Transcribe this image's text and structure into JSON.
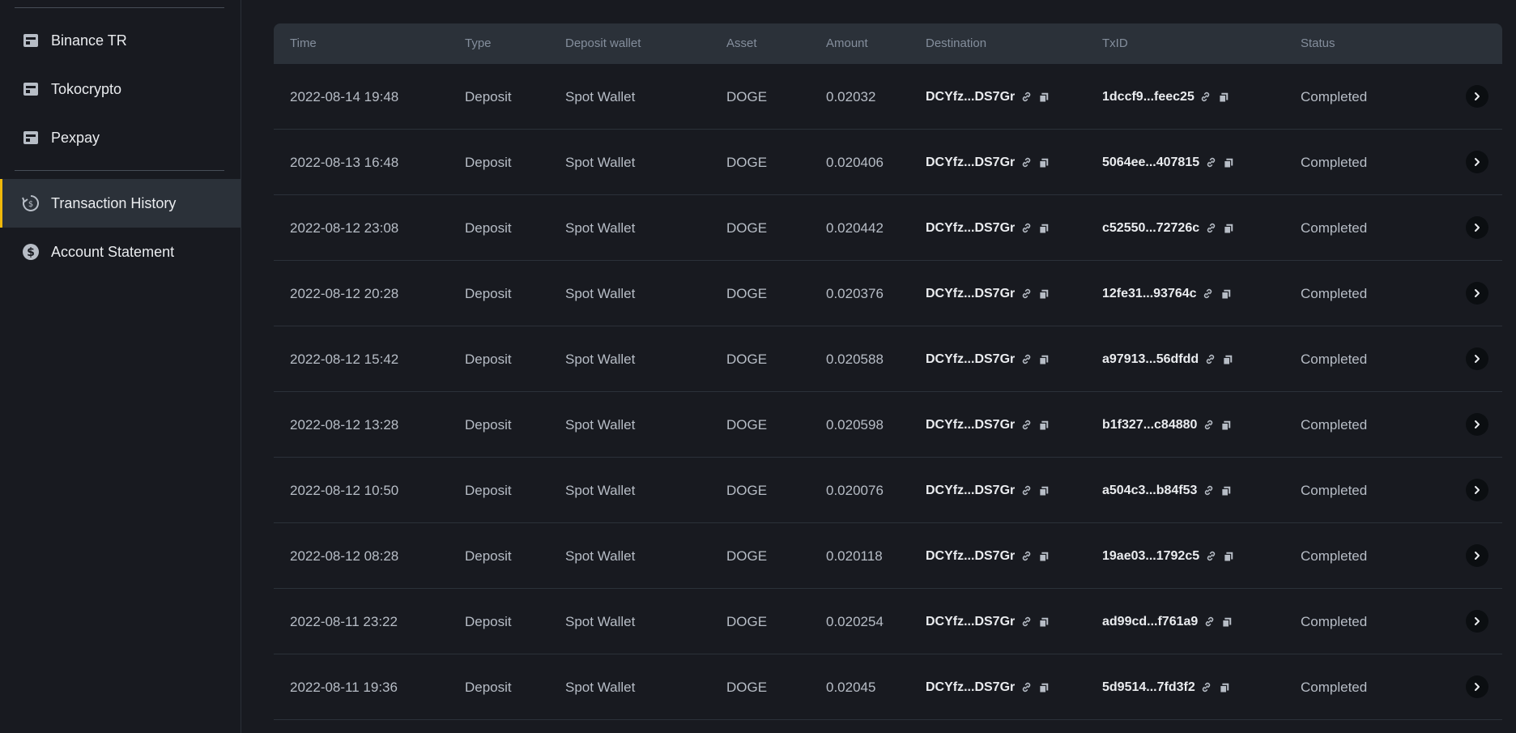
{
  "sidebar": {
    "items": [
      {
        "label": "Binance TR",
        "icon": "wallet-icon"
      },
      {
        "label": "Tokocrypto",
        "icon": "wallet-icon"
      },
      {
        "label": "Pexpay",
        "icon": "wallet-icon"
      },
      {
        "label": "Transaction History",
        "icon": "history-dollar-icon",
        "active": true
      },
      {
        "label": "Account Statement",
        "icon": "dollar-circle-icon"
      }
    ]
  },
  "table": {
    "headers": {
      "time": "Time",
      "type": "Type",
      "wallet": "Deposit wallet",
      "asset": "Asset",
      "amount": "Amount",
      "destination": "Destination",
      "txid": "TxID",
      "status": "Status"
    },
    "rows": [
      {
        "time": "2022-08-14 19:48",
        "type": "Deposit",
        "wallet": "Spot Wallet",
        "asset": "DOGE",
        "amount": "0.02032",
        "destination": "DCYfz...DS7Gr",
        "txid": "1dccf9...feec25",
        "status": "Completed"
      },
      {
        "time": "2022-08-13 16:48",
        "type": "Deposit",
        "wallet": "Spot Wallet",
        "asset": "DOGE",
        "amount": "0.020406",
        "destination": "DCYfz...DS7Gr",
        "txid": "5064ee...407815",
        "status": "Completed"
      },
      {
        "time": "2022-08-12 23:08",
        "type": "Deposit",
        "wallet": "Spot Wallet",
        "asset": "DOGE",
        "amount": "0.020442",
        "destination": "DCYfz...DS7Gr",
        "txid": "c52550...72726c",
        "status": "Completed"
      },
      {
        "time": "2022-08-12 20:28",
        "type": "Deposit",
        "wallet": "Spot Wallet",
        "asset": "DOGE",
        "amount": "0.020376",
        "destination": "DCYfz...DS7Gr",
        "txid": "12fe31...93764c",
        "status": "Completed"
      },
      {
        "time": "2022-08-12 15:42",
        "type": "Deposit",
        "wallet": "Spot Wallet",
        "asset": "DOGE",
        "amount": "0.020588",
        "destination": "DCYfz...DS7Gr",
        "txid": "a97913...56dfdd",
        "status": "Completed"
      },
      {
        "time": "2022-08-12 13:28",
        "type": "Deposit",
        "wallet": "Spot Wallet",
        "asset": "DOGE",
        "amount": "0.020598",
        "destination": "DCYfz...DS7Gr",
        "txid": "b1f327...c84880",
        "status": "Completed"
      },
      {
        "time": "2022-08-12 10:50",
        "type": "Deposit",
        "wallet": "Spot Wallet",
        "asset": "DOGE",
        "amount": "0.020076",
        "destination": "DCYfz...DS7Gr",
        "txid": "a504c3...b84f53",
        "status": "Completed"
      },
      {
        "time": "2022-08-12 08:28",
        "type": "Deposit",
        "wallet": "Spot Wallet",
        "asset": "DOGE",
        "amount": "0.020118",
        "destination": "DCYfz...DS7Gr",
        "txid": "19ae03...1792c5",
        "status": "Completed"
      },
      {
        "time": "2022-08-11 23:22",
        "type": "Deposit",
        "wallet": "Spot Wallet",
        "asset": "DOGE",
        "amount": "0.020254",
        "destination": "DCYfz...DS7Gr",
        "txid": "ad99cd...f761a9",
        "status": "Completed"
      },
      {
        "time": "2022-08-11 19:36",
        "type": "Deposit",
        "wallet": "Spot Wallet",
        "asset": "DOGE",
        "amount": "0.02045",
        "destination": "DCYfz...DS7Gr",
        "txid": "5d9514...7fd3f2",
        "status": "Completed"
      }
    ]
  },
  "colors": {
    "background": "#181a20",
    "header": "#2b3139",
    "accent": "#f0b90b",
    "muted": "#848e9c"
  }
}
